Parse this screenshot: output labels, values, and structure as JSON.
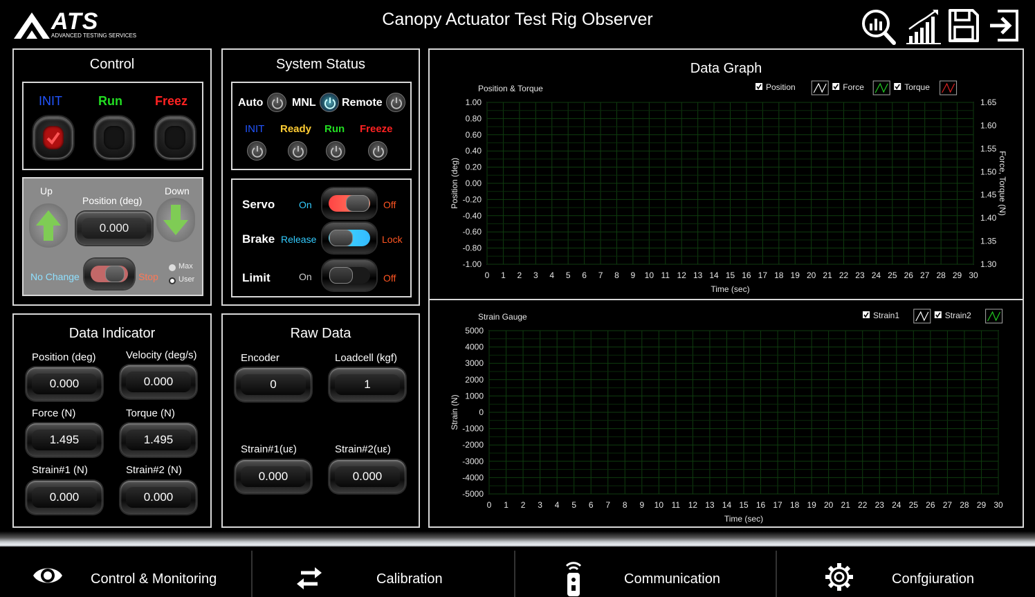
{
  "header": {
    "logo_text": "ATS",
    "logo_sub": "ADVANCED TESTING SERVICES",
    "title": "Canopy Actuator Test Rig Observer",
    "icons": [
      "analysis-icon",
      "chart-growth-icon",
      "save-icon",
      "exit-icon"
    ]
  },
  "control": {
    "title": "Control",
    "init": "INIT",
    "run": "Run",
    "freeze": "Freez",
    "up": "Up",
    "down": "Down",
    "position_label": "Position (deg)",
    "position_value": "0.000",
    "no_change": "No Change",
    "stop": "Stop",
    "max": "Max",
    "user": "User"
  },
  "system_status": {
    "title": "System Status",
    "auto": "Auto",
    "mnl": "MNL",
    "remote": "Remote",
    "init": "INIT",
    "ready": "Ready",
    "run": "Run",
    "freeze": "Freeze",
    "servo": "Servo",
    "servo_on": "On",
    "servo_off": "Off",
    "brake": "Brake",
    "brake_release": "Release",
    "brake_lock": "Lock",
    "limit": "Limit",
    "limit_on": "On",
    "limit_off": "Off"
  },
  "data_indicator": {
    "title": "Data Indicator",
    "position_label": "Position (deg)",
    "position_value": "0.000",
    "velocity_label": "Velocity (deg/s)",
    "velocity_value": "0.000",
    "force_label": "Force (N)",
    "force_value": "1.495",
    "torque_label": "Torque (N)",
    "torque_value": "1.495",
    "strain1_label": "Strain#1 (N)",
    "strain1_value": "0.000",
    "strain2_label": "Strain#2 (N)",
    "strain2_value": "0.000"
  },
  "raw_data": {
    "title": "Raw Data",
    "encoder_label": "Encoder",
    "encoder_value": "0",
    "loadcell_label": "Loadcell (kgf)",
    "loadcell_value": "1",
    "strain1_label": "Strain#1(uε)",
    "strain1_value": "0.000",
    "strain2_label": "Strain#2(uε)",
    "strain2_value": "0.000"
  },
  "data_graph": {
    "title": "Data Graph"
  },
  "chart_data": [
    {
      "type": "line",
      "title": "Position & Torque",
      "xlabel": "Time (sec)",
      "ylabel": "Position (deg)",
      "y2label": "Force, Torque (N)",
      "xlim": [
        0,
        30
      ],
      "ylim": [
        -1.0,
        1.0
      ],
      "y2lim": [
        1.3,
        1.65
      ],
      "x_ticks": [
        "0",
        "1",
        "2",
        "3",
        "4",
        "5",
        "6",
        "7",
        "8",
        "9",
        "10",
        "11",
        "12",
        "13",
        "14",
        "15",
        "16",
        "17",
        "18",
        "19",
        "20",
        "21",
        "22",
        "23",
        "24",
        "25",
        "26",
        "27",
        "28",
        "29",
        "30"
      ],
      "y_ticks": [
        "1.00",
        "0.80",
        "0.60",
        "0.40",
        "0.20",
        "0.00",
        "-0.20",
        "-0.40",
        "-0.60",
        "-0.80",
        "-1.00"
      ],
      "y2_ticks": [
        "1.65",
        "1.60",
        "1.55",
        "1.50",
        "1.45",
        "1.40",
        "1.35",
        "1.30"
      ],
      "grid": true,
      "legend_position": "top-right",
      "series": [
        {
          "name": "Position",
          "color": "#ffffff",
          "values": []
        },
        {
          "name": "Force",
          "color": "#22cc22",
          "values": []
        },
        {
          "name": "Torque",
          "color": "#dd2222",
          "values": []
        }
      ]
    },
    {
      "type": "line",
      "title": "Strain Gauge",
      "xlabel": "Time (sec)",
      "ylabel": "Strain (N)",
      "xlim": [
        0,
        30
      ],
      "ylim": [
        -5000,
        5000
      ],
      "x_ticks": [
        "0",
        "1",
        "2",
        "3",
        "4",
        "5",
        "6",
        "7",
        "8",
        "9",
        "10",
        "11",
        "12",
        "13",
        "14",
        "15",
        "16",
        "17",
        "18",
        "19",
        "20",
        "21",
        "22",
        "23",
        "24",
        "25",
        "26",
        "27",
        "28",
        "29",
        "30"
      ],
      "y_ticks": [
        "5000",
        "4000",
        "3000",
        "2000",
        "1000",
        "0",
        "-1000",
        "-2000",
        "-3000",
        "-4000",
        "-5000"
      ],
      "grid": true,
      "legend_position": "top-right",
      "series": [
        {
          "name": "Strain1",
          "color": "#ffffff",
          "values": []
        },
        {
          "name": "Strain2",
          "color": "#22cc22",
          "values": []
        }
      ]
    }
  ],
  "nav": {
    "items": [
      {
        "label": "Control & Monitoring",
        "icon": "eye-icon"
      },
      {
        "label": "Calibration",
        "icon": "swap-arrows-icon"
      },
      {
        "label": "Communication",
        "icon": "remote-icon"
      },
      {
        "label": "Confgiuration",
        "icon": "gear-icon"
      }
    ]
  },
  "colors": {
    "init": "#2255ff",
    "run": "#22dd22",
    "freeze": "#ff2222",
    "ready": "#ffcc33",
    "on_text": "#33ccff",
    "off_text": "#ff5522",
    "grid": "#0f3d0f"
  }
}
